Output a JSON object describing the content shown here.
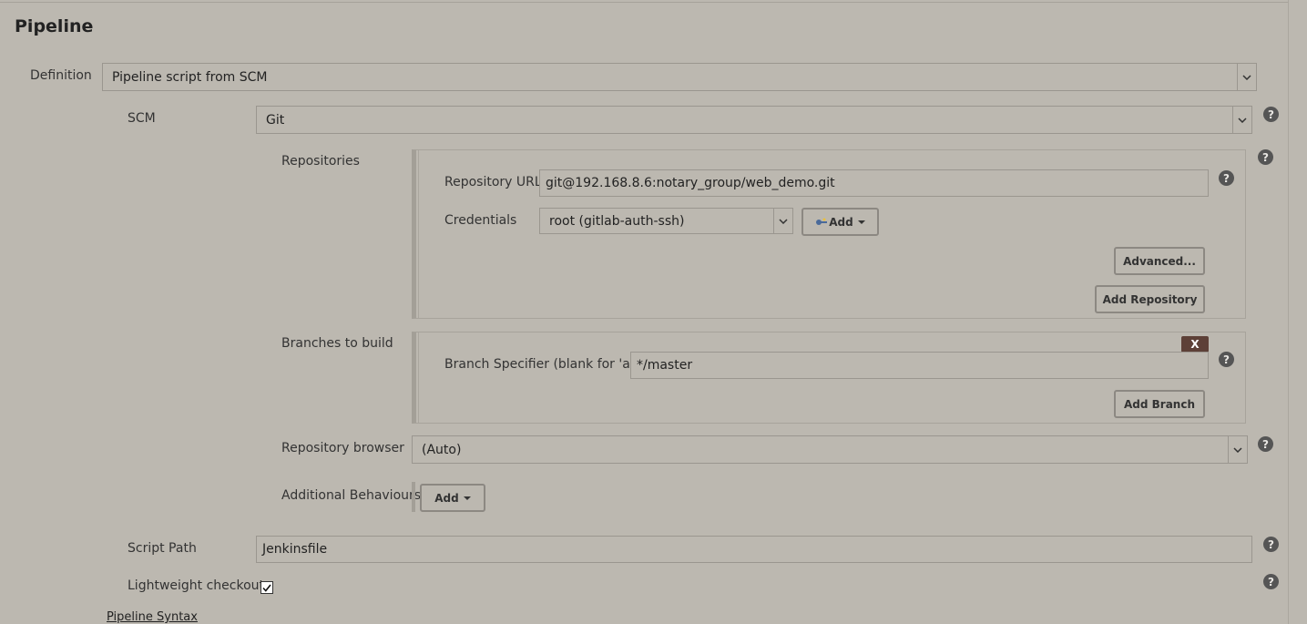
{
  "section": {
    "title": "Pipeline"
  },
  "definition": {
    "label": "Definition",
    "value": "Pipeline script from SCM"
  },
  "scm": {
    "label": "SCM",
    "value": "Git"
  },
  "repositories": {
    "label": "Repositories",
    "url_label": "Repository URL",
    "url_value": "git@192.168.8.6:notary_group/web_demo.git",
    "credentials_label": "Credentials",
    "credentials_value": "root (gitlab-auth-ssh)",
    "add_label": "Add",
    "advanced_label": "Advanced...",
    "add_repository_label": "Add Repository"
  },
  "branches": {
    "label": "Branches to build",
    "specifier_label": "Branch Specifier (blank for 'any')",
    "specifier_value": "*/master",
    "delete_label": "X",
    "add_branch_label": "Add Branch"
  },
  "repo_browser": {
    "label": "Repository browser",
    "value": "(Auto)"
  },
  "behaviours": {
    "label": "Additional Behaviours",
    "add_label": "Add"
  },
  "script_path": {
    "label": "Script Path",
    "value": "Jenkinsfile"
  },
  "lightweight": {
    "label": "Lightweight checkout",
    "checked": true
  },
  "syntax_link": {
    "label": "Pipeline Syntax"
  },
  "help_glyph": "?",
  "colors": {
    "background": "#bcb8b0",
    "delete_button": "#5d4037",
    "help_icon": "#555555"
  }
}
